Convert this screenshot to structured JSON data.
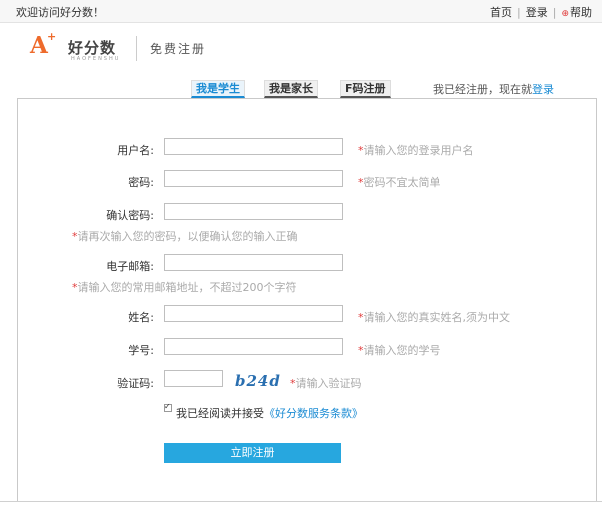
{
  "topbar": {
    "welcome": "欢迎访问好分数！",
    "home": "首页",
    "login": "登录",
    "help": "帮助"
  },
  "header": {
    "logo_letter": "A",
    "logo_plus": "+",
    "brand": "好分数",
    "brand_sub": "HAOFENSHU",
    "title": "免费注册"
  },
  "tabs": [
    {
      "label": "我是学生",
      "active": true
    },
    {
      "label": "我是家长",
      "active": false
    },
    {
      "label": "F码注册",
      "active": false
    }
  ],
  "already": {
    "text": "我已经注册，现在就",
    "link": "登录"
  },
  "form": {
    "username": {
      "label": "用户名:",
      "value": "",
      "hint": "请输入您的登录用户名"
    },
    "password": {
      "label": "密码:",
      "value": "",
      "hint": "密码不宜太简单"
    },
    "confirm": {
      "label": "确认密码:",
      "value": "",
      "hint": "请再次输入您的密码，以便确认您的输入正确"
    },
    "email": {
      "label": "电子邮箱:",
      "value": "",
      "hint": "请输入您的常用邮箱地址，不超过200个字符"
    },
    "name": {
      "label": "姓名:",
      "value": "",
      "hint": "请输入您的真实姓名,须为中文"
    },
    "student_id": {
      "label": "学号:",
      "value": "",
      "hint": "请输入您的学号"
    },
    "captcha": {
      "label": "验证码:",
      "value": "",
      "image_text": "b24d",
      "hint": "请输入验证码"
    },
    "agree": {
      "text": "我已经阅读并接受",
      "link": "《好分数服务条款》",
      "checked": true
    },
    "submit": "立即注册"
  },
  "colors": {
    "accent": "#27a7df",
    "link": "#1a8bd3",
    "required": "#e03b3b",
    "brand": "#ee6b2c"
  }
}
